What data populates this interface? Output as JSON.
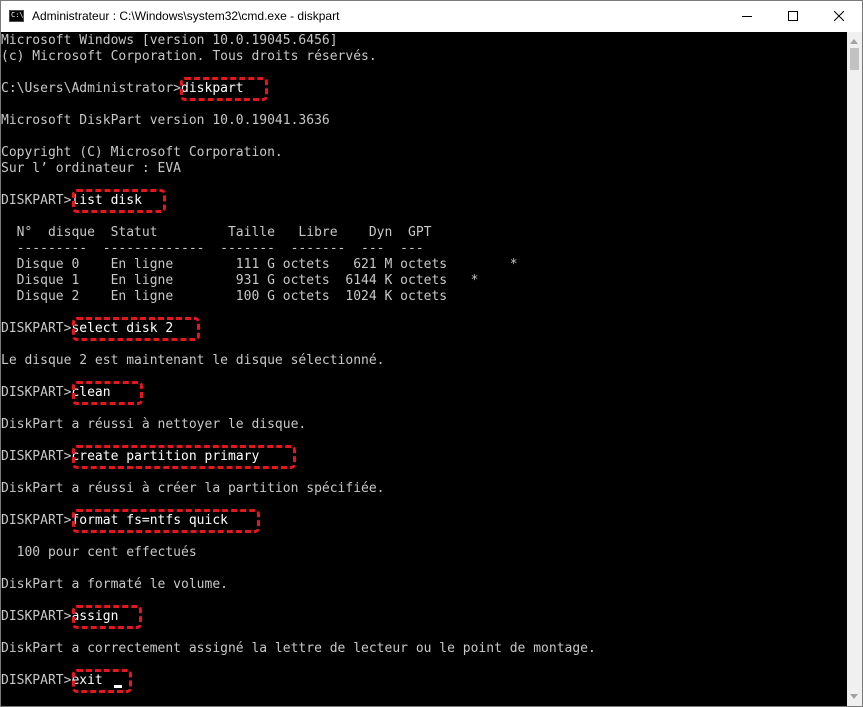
{
  "window": {
    "title": "Administrateur : C:\\Windows\\system32\\cmd.exe - diskpart",
    "icon": "cmd-icon",
    "icon_glyph": "C:\\",
    "controls": [
      "minimize-icon",
      "maximize-icon",
      "close-icon"
    ]
  },
  "colors": {
    "highlight": "#e8141e",
    "console_bg": "#000000",
    "console_text": "#c8c8c8"
  },
  "console": {
    "header": {
      "line1": "Microsoft Windows [version 10.0.19045.6456]",
      "line2": "(c) Microsoft Corporation. Tous droits réservés."
    },
    "session": {
      "prompt": "C:\\Users\\Administrator>",
      "command": "diskpart",
      "version": "Microsoft DiskPart version 10.0.19041.3636",
      "copyright": "Copyright (C) Microsoft Corporation.",
      "computer": "Sur l’ ordinateur : EVA"
    },
    "diskpart_prompt": "DISKPART>",
    "commands": {
      "list_disk": "list disk",
      "select_disk": "select disk 2",
      "clean": "clean",
      "create_partition": "create partition primary",
      "format": "format fs=ntfs quick",
      "assign": "assign",
      "exit": "exit"
    },
    "disk_table": {
      "header": "  N°  disque  Statut         Taille   Libre    Dyn  GPT",
      "divider": "  ---------  -------------  -------  -------  ---  ---",
      "rows": [
        "  Disque 0    En ligne        111 G octets   621 M octets        *",
        "  Disque 1    En ligne        931 G octets  6144 K octets   *",
        "  Disque 2    En ligne        100 G octets  1024 K octets"
      ]
    },
    "outputs": {
      "select": "Le disque 2 est maintenant le disque sélectionné.",
      "clean": "DiskPart a réussi à nettoyer le disque.",
      "create": "DiskPart a réussi à créer la partition spécifiée.",
      "progress": "  100 pour cent effectués",
      "format": "DiskPart a formaté le volume.",
      "assign": "DiskPart a correctement assigné la lettre de lecteur ou le point de montage."
    }
  },
  "scrollbar": {
    "up": "scroll-up-arrow-icon",
    "down": "scroll-down-arrow-icon"
  }
}
